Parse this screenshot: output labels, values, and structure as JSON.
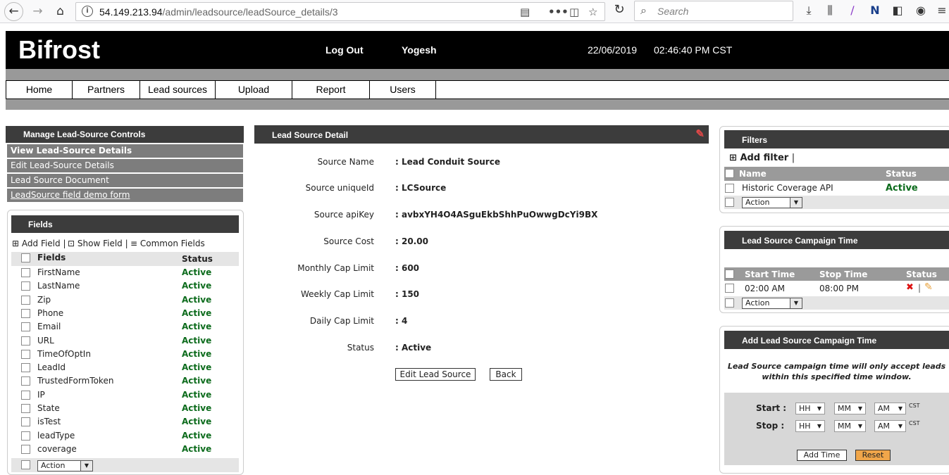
{
  "browser": {
    "url_host": "54.149.213.94",
    "url_path": "/admin/leadsource/leadSource_details/3",
    "search_placeholder": "Search"
  },
  "header": {
    "brand": "Bifrost",
    "logout": "Log Out",
    "user": "Yogesh",
    "date": "22/06/2019",
    "time": "02:46:40 PM CST"
  },
  "menu": [
    "Home",
    "Partners",
    "Lead sources",
    "Upload",
    "Report",
    "Users"
  ],
  "left": {
    "controls_title": "Manage Lead-Source Controls",
    "links": [
      "View Lead-Source Details",
      "Edit Lead-Source Details",
      "Lead Source Document",
      "LeadSource field demo form"
    ],
    "fields_title": "Fields",
    "tools": [
      "Add Field",
      "Show Field",
      "Common Fields"
    ],
    "col_fields": "Fields",
    "col_status": "Status",
    "fields": [
      "FirstName",
      "LastName",
      "Zip",
      "Phone",
      "Email",
      "URL",
      "TimeOfOptIn",
      "LeadId",
      "TrustedFormToken",
      "IP",
      "State",
      "isTest",
      "leadType",
      "coverage"
    ],
    "status": "Active",
    "action": "Action"
  },
  "detail": {
    "title": "Lead Source Detail",
    "labels": [
      "Source Name",
      "Source uniqueId",
      "Source apiKey",
      "Source Cost",
      "Monthly Cap Limit",
      "Weekly Cap Limit",
      "Daily Cap Limit",
      "Status"
    ],
    "values": [
      ": Lead Conduit Source",
      ": LCSource",
      ": avbxYH4O4ASguEkbShhPuOwwgDcYi9BX",
      ": 20.00",
      ": 600",
      ": 150",
      ": 4",
      ": Active"
    ],
    "edit_button": "Edit Lead Source",
    "back_button": "Back"
  },
  "filters": {
    "title": "Filters",
    "add": "Add filter",
    "sep": "|",
    "col_name": "Name",
    "col_status": "Status",
    "row_name": "Historic Coverage API",
    "row_status": "Active",
    "action": "Action"
  },
  "campaign": {
    "title": "Lead Source Campaign Time",
    "col_start": "Start Time",
    "col_stop": "Stop Time",
    "col_status": "Status",
    "start": "02:00 AM",
    "stop": "08:00 PM",
    "action": "Action"
  },
  "add_campaign": {
    "title": "Add Lead Source Campaign Time",
    "note": "Lead Source campaign time will only accept leads within this specified time window.",
    "start_label": "Start :",
    "stop_label": "Stop :",
    "hh": "HH",
    "mm": "MM",
    "ampm": "AM",
    "tz": "CST",
    "add_button": "Add Time",
    "reset_button": "Reset"
  },
  "colors": {
    "header_bg": "#000000",
    "panel_head": "#3c3c3c",
    "active_green": "#0c6b1c",
    "reset_orange": "#f0a64a",
    "edit_red": "#e04848"
  }
}
